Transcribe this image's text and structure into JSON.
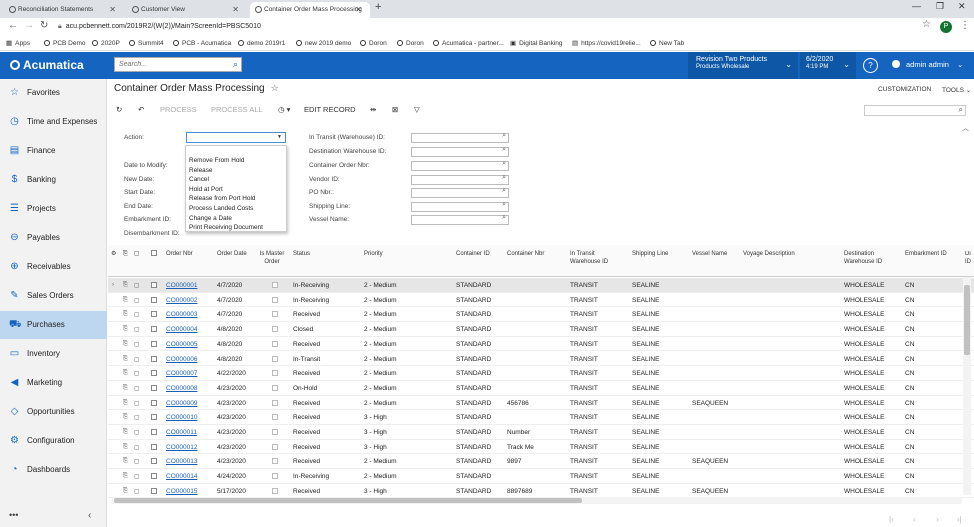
{
  "browser": {
    "tabs": [
      {
        "title": "Reconciliation Statements"
      },
      {
        "title": "Customer View"
      },
      {
        "title": "Container Order Mass Processing"
      }
    ],
    "url": "acu.pcbennett.com/2019R2/(W(2))/Main?ScreenId=PBSC5010",
    "profile_initial": "P",
    "bookmarks": [
      {
        "label": "Apps"
      },
      {
        "label": "PCB Demo"
      },
      {
        "label": "2020P"
      },
      {
        "label": "Summit4"
      },
      {
        "label": "PCB - Acumatica"
      },
      {
        "label": "demo 2019r1"
      },
      {
        "label": "new 2019 demo"
      },
      {
        "label": "Doron"
      },
      {
        "label": "Doron"
      },
      {
        "label": "Acumatica - partner..."
      },
      {
        "label": "Digital Banking"
      },
      {
        "label": "https://covid19relie..."
      },
      {
        "label": "New Tab"
      }
    ]
  },
  "header": {
    "logo": "Acumatica",
    "search_placeholder": "Search...",
    "company_name": "Revision Two Products",
    "branch": "Products Wholesale",
    "date": "6/2/2020",
    "time": "4:19 PM",
    "user": "admin admin"
  },
  "sidebar": {
    "items": [
      {
        "label": "Favorites",
        "icon": "star-icon"
      },
      {
        "label": "Time and Expenses",
        "icon": "clock-icon"
      },
      {
        "label": "Finance",
        "icon": "finance-icon"
      },
      {
        "label": "Banking",
        "icon": "dollar-icon"
      },
      {
        "label": "Projects",
        "icon": "projects-icon"
      },
      {
        "label": "Payables",
        "icon": "minus-circle-icon"
      },
      {
        "label": "Receivables",
        "icon": "plus-circle-icon"
      },
      {
        "label": "Sales Orders",
        "icon": "pencil-icon"
      },
      {
        "label": "Purchases",
        "icon": "cart-icon"
      },
      {
        "label": "Inventory",
        "icon": "truck-icon"
      },
      {
        "label": "Marketing",
        "icon": "megaphone-icon"
      },
      {
        "label": "Opportunities",
        "icon": "tag-icon"
      },
      {
        "label": "Configuration",
        "icon": "gear-icon"
      },
      {
        "label": "Dashboards",
        "icon": "dashboard-icon"
      }
    ],
    "active": "Purchases"
  },
  "page": {
    "title": "Container Order Mass Processing",
    "customization": "CUSTOMIZATION",
    "tools": "TOOLS",
    "toolbar": {
      "process": "PROCESS",
      "process_all": "PROCESS ALL",
      "edit_record": "EDIT RECORD"
    }
  },
  "filters": {
    "left": [
      "Action:",
      "Date to Modify:",
      "New Date:",
      "Start Date:",
      "End Date:",
      "Embarkment ID:",
      "Disembarkment ID:"
    ],
    "right": [
      "In Transit (Warehouse) ID:",
      "Destination Warehouse ID:",
      "Container Order Nbr:",
      "Vendor ID:",
      "PO Nbr.:",
      "Shipping Line:",
      "Vessel Name:"
    ],
    "action_options": [
      "Remove From Hold",
      "Release",
      "Cancel",
      "Hold at Port",
      "Release from Port Hold",
      "Process Landed Costs",
      "Change a Date",
      "Print Receiving Document"
    ]
  },
  "grid": {
    "columns": [
      "Order Nbr",
      "Order Date",
      "Is Master Order",
      "Status",
      "Priority",
      "Container ID",
      "Container Nbr",
      "In Transit Warehouse ID",
      "Shipping Line",
      "Vessel Name",
      "Voyage Description",
      "Destination Warehouse ID",
      "Embarkment ID",
      "Di ID"
    ],
    "rows": [
      {
        "nbr": "CO000001",
        "date": "4/7/2020",
        "status": "In-Receiving",
        "priority": "2 - Medium",
        "container": "STANDARD",
        "cnbr": "",
        "transit": "TRANSIT",
        "line": "SEALINE",
        "vessel": "",
        "dest": "WHOLESALE",
        "emb": "CN"
      },
      {
        "nbr": "CO000002",
        "date": "4/7/2020",
        "status": "In-Receiving",
        "priority": "2 - Medium",
        "container": "STANDARD",
        "cnbr": "",
        "transit": "TRANSIT",
        "line": "SEALINE",
        "vessel": "",
        "dest": "WHOLESALE",
        "emb": "CN"
      },
      {
        "nbr": "CO000003",
        "date": "4/7/2020",
        "status": "Received",
        "priority": "2 - Medium",
        "container": "STANDARD",
        "cnbr": "",
        "transit": "TRANSIT",
        "line": "SEALINE",
        "vessel": "",
        "dest": "WHOLESALE",
        "emb": "CN"
      },
      {
        "nbr": "CO000004",
        "date": "4/8/2020",
        "status": "Closed",
        "priority": "2 - Medium",
        "container": "STANDARD",
        "cnbr": "",
        "transit": "TRANSIT",
        "line": "SEALINE",
        "vessel": "",
        "dest": "WHOLESALE",
        "emb": "CN"
      },
      {
        "nbr": "CO000005",
        "date": "4/8/2020",
        "status": "Received",
        "priority": "2 - Medium",
        "container": "STANDARD",
        "cnbr": "",
        "transit": "TRANSIT",
        "line": "SEALINE",
        "vessel": "",
        "dest": "WHOLESALE",
        "emb": "CN"
      },
      {
        "nbr": "CO000006",
        "date": "4/8/2020",
        "status": "In-Transit",
        "priority": "2 - Medium",
        "container": "STANDARD",
        "cnbr": "",
        "transit": "TRANSIT",
        "line": "SEALINE",
        "vessel": "",
        "dest": "WHOLESALE",
        "emb": "CN"
      },
      {
        "nbr": "CO000007",
        "date": "4/22/2020",
        "status": "Received",
        "priority": "2 - Medium",
        "container": "STANDARD",
        "cnbr": "",
        "transit": "TRANSIT",
        "line": "SEALINE",
        "vessel": "",
        "dest": "WHOLESALE",
        "emb": "CN"
      },
      {
        "nbr": "CO000008",
        "date": "4/23/2020",
        "status": "On-Hold",
        "priority": "2 - Medium",
        "container": "STANDARD",
        "cnbr": "",
        "transit": "TRANSIT",
        "line": "SEALINE",
        "vessel": "",
        "dest": "WHOLESALE",
        "emb": "CN"
      },
      {
        "nbr": "CO000009",
        "date": "4/23/2020",
        "status": "Received",
        "priority": "2 - Medium",
        "container": "STANDARD",
        "cnbr": "456786",
        "transit": "TRANSIT",
        "line": "SEALINE",
        "vessel": "SEAQUEEN",
        "dest": "WHOLESALE",
        "emb": "CN"
      },
      {
        "nbr": "CO000010",
        "date": "4/23/2020",
        "status": "Received",
        "priority": "3 - High",
        "container": "STANDARD",
        "cnbr": "",
        "transit": "TRANSIT",
        "line": "SEALINE",
        "vessel": "",
        "dest": "WHOLESALE",
        "emb": "CN"
      },
      {
        "nbr": "CO000011",
        "date": "4/23/2020",
        "status": "Received",
        "priority": "3 - High",
        "container": "STANDARD",
        "cnbr": "Number",
        "transit": "TRANSIT",
        "line": "SEALINE",
        "vessel": "",
        "dest": "WHOLESALE",
        "emb": "CN"
      },
      {
        "nbr": "CO000012",
        "date": "4/23/2020",
        "status": "Received",
        "priority": "3 - High",
        "container": "STANDARD",
        "cnbr": "Track Me",
        "transit": "TRANSIT",
        "line": "SEALINE",
        "vessel": "",
        "dest": "WHOLESALE",
        "emb": "CN"
      },
      {
        "nbr": "CO000013",
        "date": "4/23/2020",
        "status": "Received",
        "priority": "2 - Medium",
        "container": "STANDARD",
        "cnbr": "9897",
        "transit": "TRANSIT",
        "line": "SEALINE",
        "vessel": "SEAQUEEN",
        "dest": "WHOLESALE",
        "emb": "CN"
      },
      {
        "nbr": "CO000014",
        "date": "4/24/2020",
        "status": "In-Receiving",
        "priority": "2 - Medium",
        "container": "STANDARD",
        "cnbr": "",
        "transit": "TRANSIT",
        "line": "SEALINE",
        "vessel": "",
        "dest": "WHOLESALE",
        "emb": "CN"
      },
      {
        "nbr": "CO000015",
        "date": "5/17/2020",
        "status": "Received",
        "priority": "3 - High",
        "container": "STANDARD",
        "cnbr": "8897689",
        "transit": "TRANSIT",
        "line": "SEALINE",
        "vessel": "SEAQUEEN",
        "dest": "WHOLESALE",
        "emb": "CN"
      }
    ]
  },
  "colors": {
    "brand": "#1565c0",
    "active_nav": "#bcd7ef",
    "link": "#1a5fb4"
  }
}
